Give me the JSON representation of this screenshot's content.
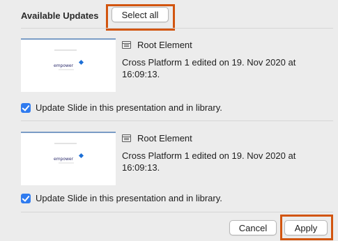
{
  "header": {
    "title": "Available Updates",
    "select_all_label": "Select all"
  },
  "items": [
    {
      "thumbnail_text": "empower",
      "element_icon": "element-icon",
      "element_label": "Root Element",
      "description": "Cross Platform 1 edited on 19. Nov 2020 at 16:09:13.",
      "checkbox_label": "Update Slide in this presentation and in library.",
      "checked": true
    },
    {
      "thumbnail_text": "empower",
      "element_icon": "element-icon",
      "element_label": "Root Element",
      "description": "Cross Platform 1 edited on 19. Nov 2020 at 16:09:13.",
      "checkbox_label": "Update Slide in this presentation and in library.",
      "checked": true
    }
  ],
  "footer": {
    "cancel_label": "Cancel",
    "apply_label": "Apply"
  },
  "colors": {
    "highlight": "#d2550f",
    "checkbox": "#2f7bef"
  }
}
